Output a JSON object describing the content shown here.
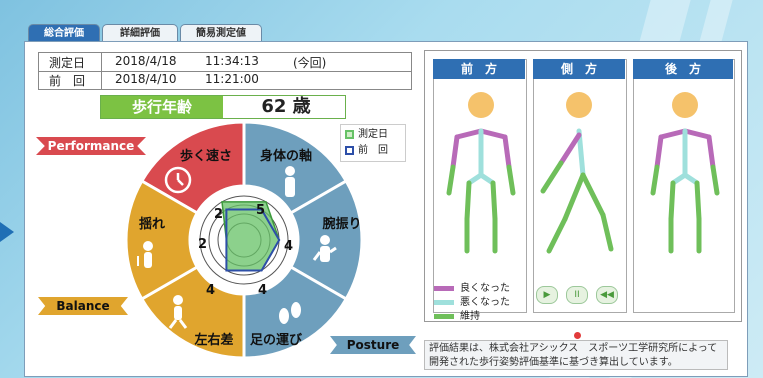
{
  "tabs": [
    {
      "label": "総合評価"
    },
    {
      "label": "詳細評価"
    },
    {
      "label": "簡易測定値"
    }
  ],
  "measurement": {
    "current": {
      "label": "測定日",
      "date": "2018/4/18",
      "time": "11:34:13",
      "note": "(今回)"
    },
    "previous": {
      "label": "前　回",
      "date": "2018/4/10",
      "time": "11:21:00"
    }
  },
  "walking_age": {
    "label": "歩行年齢",
    "value": "62 歳"
  },
  "categories": {
    "performance": "Performance",
    "balance": "Balance",
    "posture": "Posture"
  },
  "segments": [
    "歩く速さ",
    "身体の軸",
    "腕振り",
    "足の運び",
    "左右差",
    "揺れ"
  ],
  "segment_colors": {
    "performance": "#d94a4f",
    "posture": "#6e9fbd",
    "balance": "#e0a52e"
  },
  "radar": {
    "axes": [
      "歩く速さ",
      "身体の軸",
      "腕振り",
      "足の運び",
      "左右差",
      "揺れ"
    ],
    "current": [
      5,
      5,
      4,
      4,
      4,
      2
    ],
    "previous": [
      4,
      4,
      4,
      4,
      4,
      2
    ],
    "labels": [
      "5",
      "4",
      "4",
      "4",
      "2",
      "2"
    ],
    "legend": {
      "current": "測定日",
      "previous": "前　回"
    }
  },
  "body_views": {
    "front": "前　方",
    "side": "側　方",
    "back": "後　方"
  },
  "skeleton_legend": {
    "improved": "良くなった",
    "worsened": "悪くなった",
    "maintained": "維持"
  },
  "colors": {
    "improved": "#b86ab8",
    "worsened": "#9fe0dc",
    "maintained": "#6fbf5a",
    "current": "#66c266",
    "previous": "#2d4fa8"
  },
  "playback": {
    "play": "▶",
    "pause": "II",
    "rewind": "◀◀"
  },
  "footnote": "評価結果は、株式会社アシックス　スポーツ工学研究所によって開発された歩行姿勢評価基準に基づき算出しています。"
}
